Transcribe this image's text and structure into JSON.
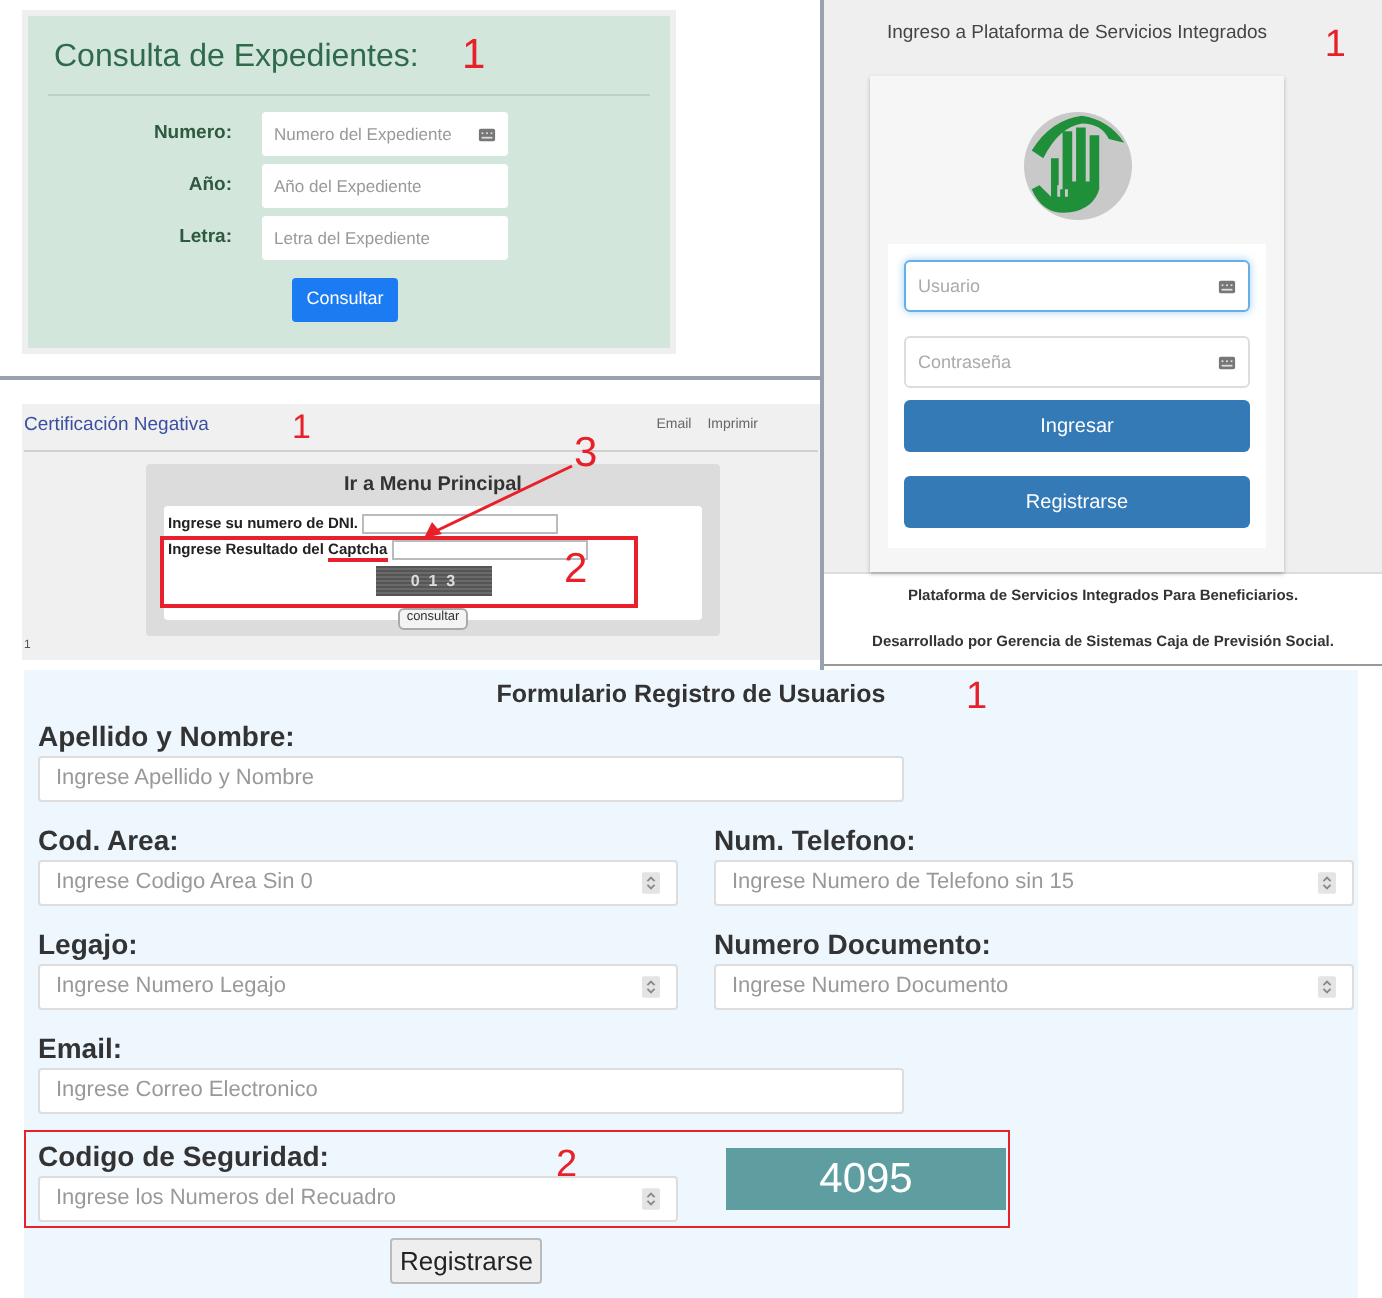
{
  "expedientes": {
    "title": "Consulta de Expedientes:",
    "annotation": "1",
    "fields": [
      {
        "label": "Numero:",
        "placeholder": "Numero del Expediente",
        "icon": true
      },
      {
        "label": "Año:",
        "placeholder": "Año del Expediente",
        "icon": false
      },
      {
        "label": "Letra:",
        "placeholder": "Letra del Expediente",
        "icon": false
      }
    ],
    "button": "Consultar"
  },
  "certificacion": {
    "title": "Certificación Negativa",
    "annotation": "1",
    "links": [
      "Email",
      "Imprimir"
    ],
    "box_title": "Ir a Menu Principal",
    "dni_label": "Ingrese su numero de DNI.",
    "captcha_label": "Ingrese Resultado del **Captcha**",
    "captcha_image": "0  1  3",
    "button": "consultar",
    "page_number": "1",
    "annotation_box": "2",
    "annotation_arrow": "3"
  },
  "login": {
    "title": "Ingreso a Plataforma de Servicios Integrados",
    "annotation": "1",
    "fields": [
      {
        "placeholder": "Usuario",
        "focused": true
      },
      {
        "placeholder": "Contraseña",
        "focused": false
      }
    ],
    "buttons": [
      "Ingresar",
      "Registrarse"
    ],
    "footer_1": "Plataforma de Servicios Integrados Para Beneficiarios.",
    "footer_2": "Desarrollado por Gerencia de Sistemas Caja de Previsión Social."
  },
  "registro": {
    "title": "Formulario Registro de Usuarios",
    "annotation": "1",
    "rows": [
      [
        {
          "label": "Apellido y Nombre:",
          "placeholder": "Ingrese Apellido y Nombre",
          "kind": "text"
        }
      ],
      [
        {
          "label": "Cod. Area:",
          "placeholder": "Ingrese Codigo Area Sin 0",
          "kind": "number"
        },
        {
          "label": "Num. Telefono:",
          "placeholder": "Ingrese Numero de Telefono sin 15",
          "kind": "number"
        }
      ],
      [
        {
          "label": "Legajo:",
          "placeholder": "Ingrese Numero Legajo",
          "kind": "number"
        },
        {
          "label": "Numero Documento:",
          "placeholder": "Ingrese Numero Documento",
          "kind": "number"
        }
      ],
      [
        {
          "label": "Email:",
          "placeholder": "Ingrese Correo Electronico",
          "kind": "text"
        }
      ]
    ],
    "security": {
      "label": "Codigo de Seguridad:",
      "placeholder": "Ingrese los Numeros del Recuadro",
      "code": "4095",
      "annotation": "2"
    },
    "button": "Registrarse"
  }
}
